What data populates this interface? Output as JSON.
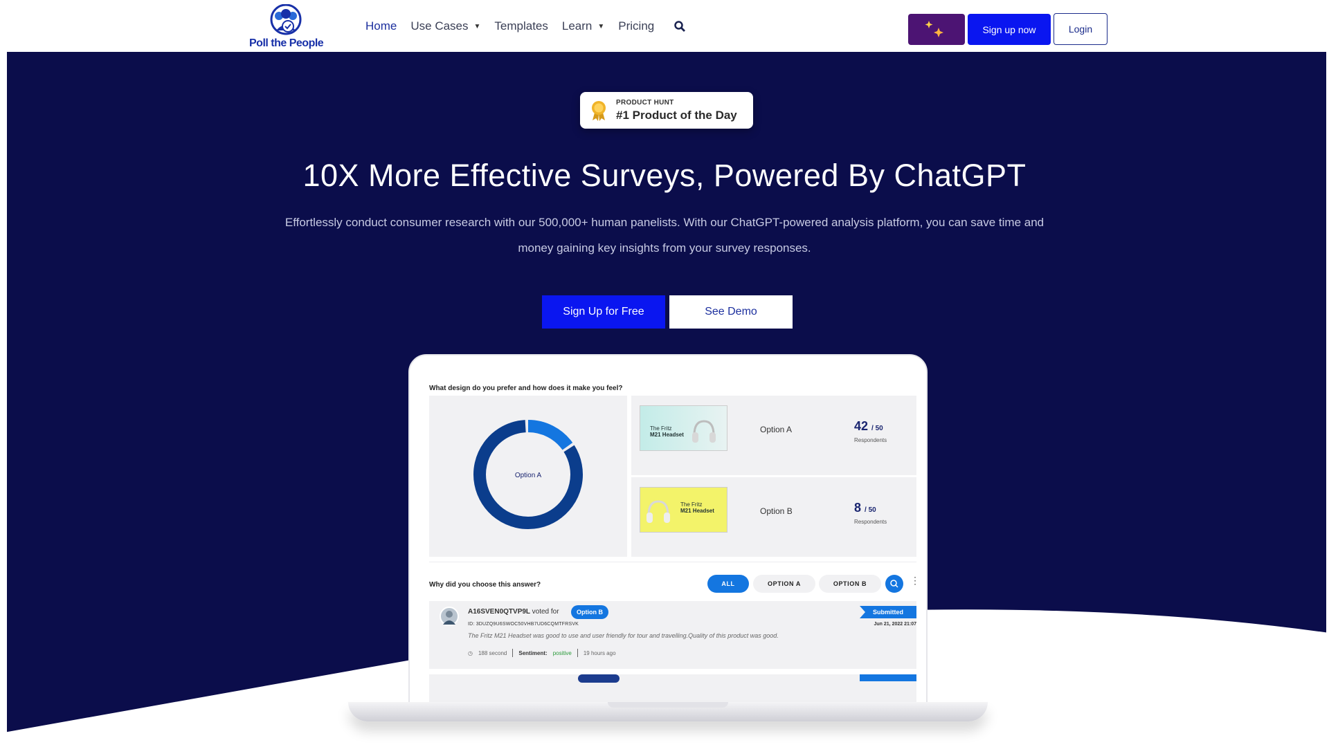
{
  "nav": {
    "logo_text": "Poll the People",
    "links": [
      {
        "label": "Home"
      },
      {
        "label": "Use Cases"
      },
      {
        "label": "Templates"
      },
      {
        "label": "Learn"
      },
      {
        "label": "Pricing"
      }
    ],
    "signup_label": "Sign up now",
    "login_label": "Login"
  },
  "hero": {
    "badge_small": "PRODUCT HUNT",
    "badge_big": "#1 Product of the Day",
    "title": "10X More Effective Surveys, Powered By ChatGPT",
    "subtitle": "Effortlessly conduct consumer research with our 500,000+ human panelists. With our ChatGPT-powered analysis platform, you can save time and money gaining key insights from your survey responses.",
    "cta_primary": "Sign Up for Free",
    "cta_secondary": "See Demo"
  },
  "mockup": {
    "question1": "What design do you prefer and how does it make you feel?",
    "donut_label": "Option A",
    "donut_fraction_a": 0.84,
    "options": [
      {
        "label": "Option A",
        "count": "42",
        "total": "/ 50",
        "resp_label": "Respondents",
        "img_title_1": "The Fritz",
        "img_title_2": "M21 Headset"
      },
      {
        "label": "Option B",
        "count": "8",
        "total": "/ 50",
        "resp_label": "Respondents",
        "img_title_1": "The Fritz",
        "img_title_2": "M21 Headset"
      }
    ],
    "question2": "Why did you choose this answer?",
    "filters": [
      "ALL",
      "OPTION A",
      "OPTION B"
    ],
    "response": {
      "user": "A16SVEN0QTVP9L",
      "voted_for": "voted for",
      "option_tag": "Option B",
      "id": "ID: 3DUZQ9U6SWOC50VHB7UD6CQMTFRSVK",
      "text": "The Fritz M21 Headset was good to use and user friendly for tour and travelling.Quality of this product was good.",
      "duration": "188 second",
      "sentiment_label": "Sentiment:",
      "sentiment_value": "positive",
      "ago": "19 hours ago",
      "status": "Submitted",
      "date": "Jun 21, 2022 21:07"
    }
  },
  "colors": {
    "hero_bg": "#0b0d4b",
    "primary_blue": "#0a16f0",
    "accent_blue": "#1476e0",
    "donut_dark": "#0b3d8c",
    "donut_light": "#1476e0",
    "sparkle_bg": "#4c1473"
  }
}
